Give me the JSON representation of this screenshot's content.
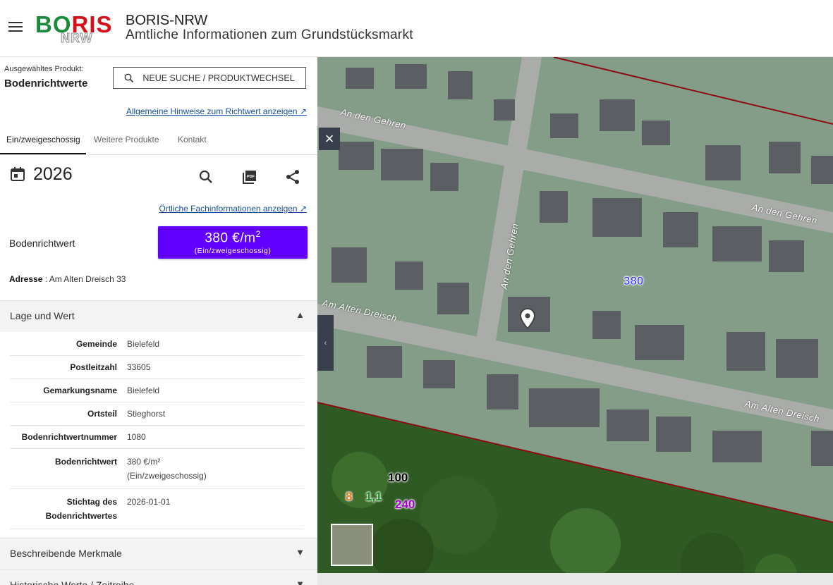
{
  "header": {
    "logo_text_1": "BO",
    "logo_text_2": "RIS",
    "logo_sub": "NRW",
    "title": "BORIS-NRW",
    "subtitle": "Amtliche Informationen zum Grundstücksmarkt"
  },
  "product": {
    "label": "Ausgewähltes Produkt:",
    "value": "Bodenrichtwerte",
    "search_button": "NEUE SUCHE / PRODUKTWECHSEL",
    "hint_link": "Allgemeine Hinweise zum Richtwert anzeigen ↗"
  },
  "tabs": [
    {
      "label": "Ein/zweigeschossig",
      "active": true
    },
    {
      "label": "Weitere Produkte",
      "active": false
    },
    {
      "label": "Kontakt",
      "active": false
    }
  ],
  "year": "2026",
  "icons": [
    "calendar-icon",
    "search-icon",
    "pdf-icon",
    "share-icon",
    "close-icon",
    "map-pin-icon"
  ],
  "local_link": "Örtliche Fachinformationen anzeigen ↗",
  "bodenrichtwert": {
    "label": "Bodenrichtwert",
    "value": "380 €/m",
    "unit_sup": "2",
    "sub": "(Ein/zweigeschossig)",
    "color": "#6100ff"
  },
  "address": {
    "label": "Adresse",
    "value": " : Am Alten Dreisch 33"
  },
  "sections": {
    "lage": "Lage und Wert",
    "beschreibende": "Beschreibende Merkmale",
    "historische": "Historische Werte / Zeitreihe"
  },
  "table": [
    {
      "key": "Gemeinde",
      "value": "Bielefeld"
    },
    {
      "key": "Postleitzahl",
      "value": "33605"
    },
    {
      "key": "Gemarkungsname",
      "value": "Bielefeld"
    },
    {
      "key": "Ortsteil",
      "value": "Stieghorst"
    },
    {
      "key": "Bodenrichtwertnummer",
      "value": "1080"
    },
    {
      "key": "Bodenrichtwert",
      "value": "380 €/m²",
      "value2": "(Ein/zweigeschossig)"
    },
    {
      "key": "Stichtag des",
      "key2": "Bodenrichtwertes",
      "value": "2026-01-01"
    }
  ],
  "map": {
    "zone_label": "380",
    "label_100": "100",
    "label_8": "8",
    "label_11": "1,1",
    "label_240": "240",
    "streets": {
      "gehren_top": "An den Gehren",
      "gehren_right": "An den Gehren",
      "gehren_vertical": "An den Gehren",
      "dreisch_left": "Am Alten Dreisch",
      "dreisch_right": "Am Alten Dreisch"
    }
  }
}
